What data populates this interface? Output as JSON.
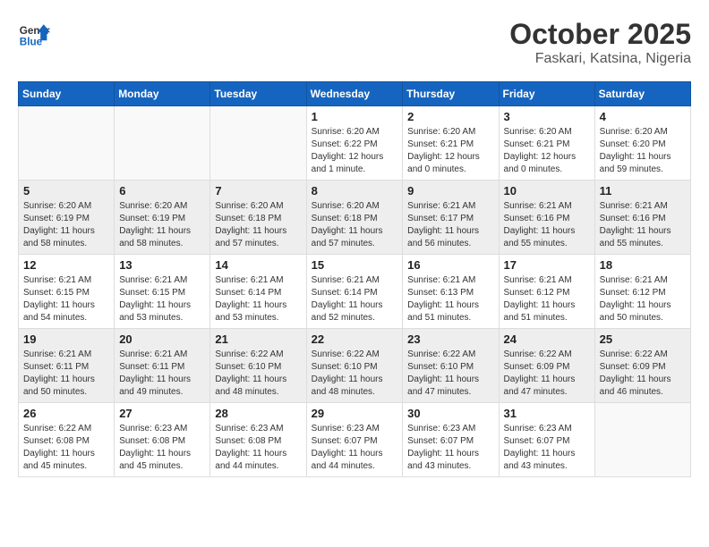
{
  "header": {
    "logo_line1": "General",
    "logo_line2": "Blue",
    "month": "October 2025",
    "location": "Faskari, Katsina, Nigeria"
  },
  "weekdays": [
    "Sunday",
    "Monday",
    "Tuesday",
    "Wednesday",
    "Thursday",
    "Friday",
    "Saturday"
  ],
  "weeks": [
    [
      {
        "day": "",
        "info": ""
      },
      {
        "day": "",
        "info": ""
      },
      {
        "day": "",
        "info": ""
      },
      {
        "day": "1",
        "info": "Sunrise: 6:20 AM\nSunset: 6:22 PM\nDaylight: 12 hours\nand 1 minute."
      },
      {
        "day": "2",
        "info": "Sunrise: 6:20 AM\nSunset: 6:21 PM\nDaylight: 12 hours\nand 0 minutes."
      },
      {
        "day": "3",
        "info": "Sunrise: 6:20 AM\nSunset: 6:21 PM\nDaylight: 12 hours\nand 0 minutes."
      },
      {
        "day": "4",
        "info": "Sunrise: 6:20 AM\nSunset: 6:20 PM\nDaylight: 11 hours\nand 59 minutes."
      }
    ],
    [
      {
        "day": "5",
        "info": "Sunrise: 6:20 AM\nSunset: 6:19 PM\nDaylight: 11 hours\nand 58 minutes."
      },
      {
        "day": "6",
        "info": "Sunrise: 6:20 AM\nSunset: 6:19 PM\nDaylight: 11 hours\nand 58 minutes."
      },
      {
        "day": "7",
        "info": "Sunrise: 6:20 AM\nSunset: 6:18 PM\nDaylight: 11 hours\nand 57 minutes."
      },
      {
        "day": "8",
        "info": "Sunrise: 6:20 AM\nSunset: 6:18 PM\nDaylight: 11 hours\nand 57 minutes."
      },
      {
        "day": "9",
        "info": "Sunrise: 6:21 AM\nSunset: 6:17 PM\nDaylight: 11 hours\nand 56 minutes."
      },
      {
        "day": "10",
        "info": "Sunrise: 6:21 AM\nSunset: 6:16 PM\nDaylight: 11 hours\nand 55 minutes."
      },
      {
        "day": "11",
        "info": "Sunrise: 6:21 AM\nSunset: 6:16 PM\nDaylight: 11 hours\nand 55 minutes."
      }
    ],
    [
      {
        "day": "12",
        "info": "Sunrise: 6:21 AM\nSunset: 6:15 PM\nDaylight: 11 hours\nand 54 minutes."
      },
      {
        "day": "13",
        "info": "Sunrise: 6:21 AM\nSunset: 6:15 PM\nDaylight: 11 hours\nand 53 minutes."
      },
      {
        "day": "14",
        "info": "Sunrise: 6:21 AM\nSunset: 6:14 PM\nDaylight: 11 hours\nand 53 minutes."
      },
      {
        "day": "15",
        "info": "Sunrise: 6:21 AM\nSunset: 6:14 PM\nDaylight: 11 hours\nand 52 minutes."
      },
      {
        "day": "16",
        "info": "Sunrise: 6:21 AM\nSunset: 6:13 PM\nDaylight: 11 hours\nand 51 minutes."
      },
      {
        "day": "17",
        "info": "Sunrise: 6:21 AM\nSunset: 6:12 PM\nDaylight: 11 hours\nand 51 minutes."
      },
      {
        "day": "18",
        "info": "Sunrise: 6:21 AM\nSunset: 6:12 PM\nDaylight: 11 hours\nand 50 minutes."
      }
    ],
    [
      {
        "day": "19",
        "info": "Sunrise: 6:21 AM\nSunset: 6:11 PM\nDaylight: 11 hours\nand 50 minutes."
      },
      {
        "day": "20",
        "info": "Sunrise: 6:21 AM\nSunset: 6:11 PM\nDaylight: 11 hours\nand 49 minutes."
      },
      {
        "day": "21",
        "info": "Sunrise: 6:22 AM\nSunset: 6:10 PM\nDaylight: 11 hours\nand 48 minutes."
      },
      {
        "day": "22",
        "info": "Sunrise: 6:22 AM\nSunset: 6:10 PM\nDaylight: 11 hours\nand 48 minutes."
      },
      {
        "day": "23",
        "info": "Sunrise: 6:22 AM\nSunset: 6:10 PM\nDaylight: 11 hours\nand 47 minutes."
      },
      {
        "day": "24",
        "info": "Sunrise: 6:22 AM\nSunset: 6:09 PM\nDaylight: 11 hours\nand 47 minutes."
      },
      {
        "day": "25",
        "info": "Sunrise: 6:22 AM\nSunset: 6:09 PM\nDaylight: 11 hours\nand 46 minutes."
      }
    ],
    [
      {
        "day": "26",
        "info": "Sunrise: 6:22 AM\nSunset: 6:08 PM\nDaylight: 11 hours\nand 45 minutes."
      },
      {
        "day": "27",
        "info": "Sunrise: 6:23 AM\nSunset: 6:08 PM\nDaylight: 11 hours\nand 45 minutes."
      },
      {
        "day": "28",
        "info": "Sunrise: 6:23 AM\nSunset: 6:08 PM\nDaylight: 11 hours\nand 44 minutes."
      },
      {
        "day": "29",
        "info": "Sunrise: 6:23 AM\nSunset: 6:07 PM\nDaylight: 11 hours\nand 44 minutes."
      },
      {
        "day": "30",
        "info": "Sunrise: 6:23 AM\nSunset: 6:07 PM\nDaylight: 11 hours\nand 43 minutes."
      },
      {
        "day": "31",
        "info": "Sunrise: 6:23 AM\nSunset: 6:07 PM\nDaylight: 11 hours\nand 43 minutes."
      },
      {
        "day": "",
        "info": ""
      }
    ]
  ]
}
